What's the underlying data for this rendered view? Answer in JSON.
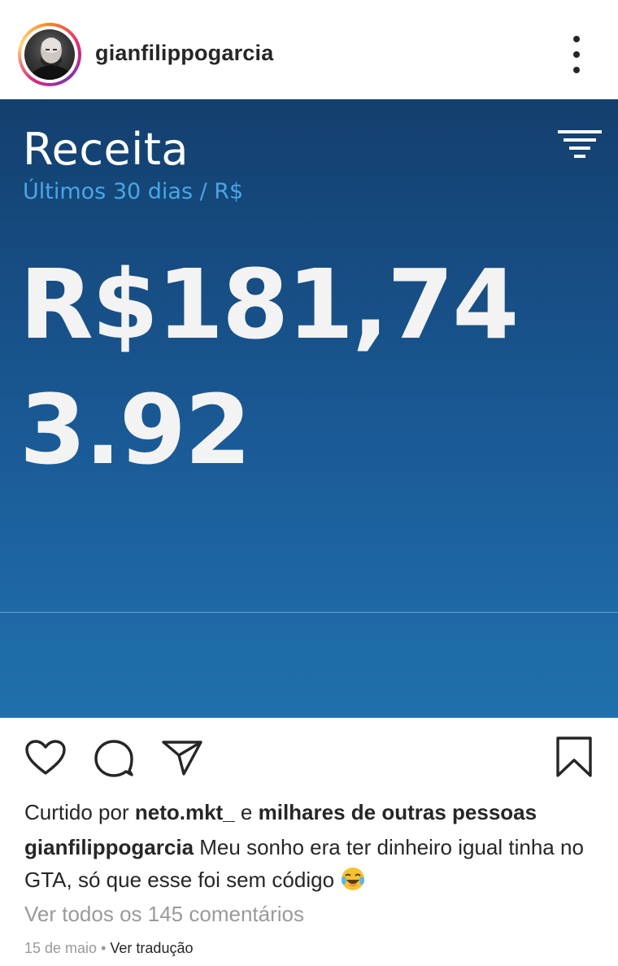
{
  "header": {
    "username": "gianfilippogarcia",
    "avatar_icon": "profile-photo",
    "more_icon": "more-vertical-icon"
  },
  "post_image": {
    "title": "Receita",
    "subtitle": "Últimos 30 dias / R$",
    "value": "R$181,743.92",
    "filter_icon": "filter-lines-icon",
    "colors": {
      "bg_top": "#133f6e",
      "bg_bottom": "#1f70ac",
      "subtitle": "#49a6e6",
      "value": "#f3f3f3"
    }
  },
  "actions": {
    "like_icon": "heart-icon",
    "comment_icon": "comment-icon",
    "share_icon": "send-icon",
    "save_icon": "bookmark-icon"
  },
  "likes": {
    "prefix": "Curtido por",
    "user": "neto.mkt_",
    "connector": "e",
    "others": "milhares de outras pessoas"
  },
  "caption": {
    "username": "gianfilippogarcia",
    "text": "Meu sonho era ter dinheiro igual tinha no GTA, só que esse foi sem código",
    "emoji": "laughing-tears-emoji"
  },
  "comments": {
    "view_all": "Ver todos os 145 comentários"
  },
  "meta": {
    "date": "15 de maio",
    "separator": "•",
    "translate": "Ver tradução"
  }
}
